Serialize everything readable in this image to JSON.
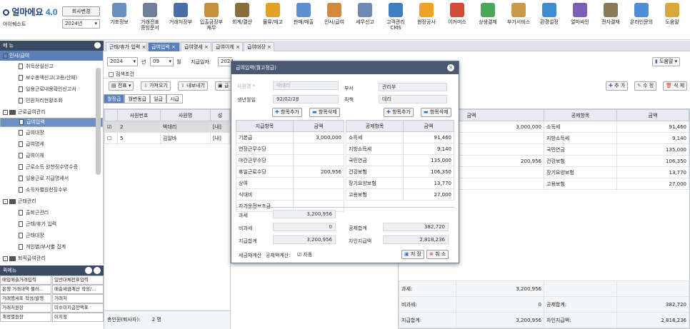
{
  "app": {
    "logo_text": "얼마에요",
    "version": "4.0",
    "company_btn": "회사변경",
    "user_name": "아이퀘스트",
    "year": "2024년"
  },
  "toolbar": [
    {
      "label": "기초정보",
      "color": "#6b8fbf"
    },
    {
      "label": "거래전표\n증빙문서",
      "color": "#6f7f99"
    },
    {
      "label": "거래처장부",
      "color": "#4a6fa8"
    },
    {
      "label": "입출금장부\n재무",
      "color": "#c7903a"
    },
    {
      "label": "회계/결산",
      "color": "#8a6d3b"
    },
    {
      "label": "물류/재고",
      "color": "#e2a227"
    },
    {
      "label": "판매/매출",
      "color": "#5f8fd0"
    },
    {
      "label": "인사/급여",
      "color": "#d2893b"
    },
    {
      "label": "세무신고",
      "color": "#6e89b3"
    },
    {
      "label": "고객관리\nCMS",
      "color": "#3f7fbf"
    },
    {
      "label": "현장공사",
      "color": "#f0a224"
    },
    {
      "label": "이커머스",
      "color": "#d24a3a"
    },
    {
      "label": "상생결제",
      "color": "#4aa85a"
    },
    {
      "label": "부가서비스",
      "color": "#c89a4a"
    },
    {
      "label": "환경설정",
      "color": "#3f8fd0"
    },
    {
      "label": "얼마싸인",
      "color": "#7a5fb5"
    },
    {
      "label": "전자결재",
      "color": "#8a7a5a"
    },
    {
      "label": "온라인문의",
      "color": "#4f8fd8"
    },
    {
      "label": "도움말",
      "color": "#d8a83a"
    }
  ],
  "sidebar": {
    "title": "메 뉴",
    "top": "인사/급여",
    "items": [
      {
        "label": "취득상실신고",
        "level": 2,
        "type": "doc"
      },
      {
        "label": "보수총액신고(고용/산재)",
        "level": 2,
        "type": "doc"
      },
      {
        "label": "일용근로내용확인신고서",
        "level": 2,
        "type": "doc"
      },
      {
        "label": "민원처리현황조회",
        "level": 2,
        "type": "doc"
      },
      {
        "label": "근로급여관리",
        "level": 1,
        "type": "folder"
      },
      {
        "label": "급여입력",
        "level": 2,
        "type": "doc",
        "selected": true
      },
      {
        "label": "급여대장",
        "level": 2,
        "type": "doc"
      },
      {
        "label": "급여명세",
        "level": 2,
        "type": "doc"
      },
      {
        "label": "급여이체",
        "level": 2,
        "type": "doc"
      },
      {
        "label": "근로소득 원천징수영수증",
        "level": 2,
        "type": "doc"
      },
      {
        "label": "일용근로 지급명세서",
        "level": 2,
        "type": "doc"
      },
      {
        "label": "소득자별원천징수부",
        "level": 2,
        "type": "doc"
      },
      {
        "label": "근태관리",
        "level": 1,
        "type": "folder"
      },
      {
        "label": "출퇴근관리",
        "level": 2,
        "type": "doc"
      },
      {
        "label": "근태/휴가 입력",
        "level": 2,
        "type": "doc"
      },
      {
        "label": "근태대장",
        "level": 2,
        "type": "doc"
      },
      {
        "label": "개인별/부서별 집계",
        "level": 2,
        "type": "doc"
      },
      {
        "label": "퇴직급여관리",
        "level": 1,
        "type": "folder"
      }
    ],
    "fav_title": "퀵메뉴",
    "favs": [
      "매입매출거래입력",
      "일반대체전표입력",
      "은행 거래내역 불러...",
      "매출세금계산 작성/...",
      "거래명세표 작성/발행",
      "거래처",
      "거래처원장",
      "미수미지급잔액표",
      "계정별원장",
      "미지정"
    ]
  },
  "tabs": [
    "근태/휴가 입력",
    "급여입력",
    "급여명세",
    "급여이체",
    "급여대장"
  ],
  "filter": {
    "year": "2024",
    "year_unit": "년",
    "month": "09",
    "month_unit": "월",
    "pay_date_label": "지급일자:",
    "pay_date": "2024",
    "search_cond": "검색조건",
    "slip_btn": "전표",
    "import_btn": "가져오기",
    "export_btn": "내보내기",
    "help_btn": "도움말",
    "add_btn": "추 가",
    "edit_btn": "수 정",
    "del_btn": "삭 제"
  },
  "subtabs": [
    "월정급",
    "월변동급",
    "일급",
    "시급"
  ],
  "emp_table": {
    "headers": [
      "사원번호",
      "사원명",
      "성"
    ],
    "rows": [
      {
        "checked": true,
        "no": "2",
        "name": "박대리",
        "tag": "[내]"
      },
      {
        "checked": false,
        "no": "5",
        "name": "김알바",
        "tag": "[내]"
      }
    ],
    "total_label": "총인원(퇴사자):",
    "total_value": "2 명"
  },
  "right_table": {
    "headers": [
      "금액",
      "공제항목",
      "금액"
    ],
    "pay_amounts": [
      "3,000,000",
      "",
      "",
      "200,956"
    ],
    "deduct_rows": [
      [
        "소득세",
        "91,460"
      ],
      [
        "지방소득세",
        "9,140"
      ],
      [
        "국민연금",
        "135,000"
      ],
      [
        "건강보험",
        "106,350"
      ],
      [
        "장기요양보험",
        "13,770"
      ],
      [
        "고용보험",
        "27,000"
      ]
    ],
    "footer": [
      {
        "label": "과세:",
        "value": "3,200,956",
        "dlabel": "",
        "dvalue": ""
      },
      {
        "label": "비과세:",
        "value": "0",
        "dlabel": "공제합계:",
        "dvalue": "382,720"
      },
      {
        "label": "지급합계:",
        "value": "3,200,956",
        "dlabel": "차인지급액:",
        "dvalue": "2,818,236"
      }
    ]
  },
  "modal": {
    "title": "급여입력(월고정급)",
    "emp_label": "사원명 *",
    "emp_value": "박대리",
    "birth_label": "생년월일",
    "birth_value": "92/02/28",
    "dept_label": "부서",
    "dept_value": "관리부",
    "pos_label": "직책",
    "pos_value": "대리",
    "add_item": "항목추가",
    "del_item": "항목삭제",
    "pay_headers": [
      "지급항목",
      "금액"
    ],
    "pay_rows": [
      [
        "기본급",
        "3,000,000"
      ],
      [
        "연장근무수당",
        ""
      ],
      [
        "야간근무수당",
        ""
      ],
      [
        "휴일근로수당",
        "200,956"
      ],
      [
        "상여",
        ""
      ],
      [
        "식대비",
        ""
      ],
      [
        "자가운전보조금",
        ""
      ]
    ],
    "ded_headers": [
      "공제항목",
      "금액"
    ],
    "ded_rows": [
      [
        "소득세",
        "91,460"
      ],
      [
        "지방소득세",
        "9,140"
      ],
      [
        "국민연금",
        "135,000"
      ],
      [
        "건강보험",
        "106,350"
      ],
      [
        "장기요양보험",
        "13,770"
      ],
      [
        "고용보험",
        "27,000"
      ]
    ],
    "taxable_label": "과세",
    "taxable": "3,200,956",
    "nontax_label": "비과세",
    "nontax": "0",
    "paysum_label": "지급합계",
    "paysum": "3,200,956",
    "dedsum_label": "공제합계",
    "dedsum": "382,720",
    "net_label": "차인지급액",
    "net": "2,818,236",
    "tax_calc_label": "세금재계산",
    "ded_calc_label": "공제액계산:",
    "auto_label": "자동",
    "save_btn": "저 장",
    "cancel_btn": "취 소"
  }
}
